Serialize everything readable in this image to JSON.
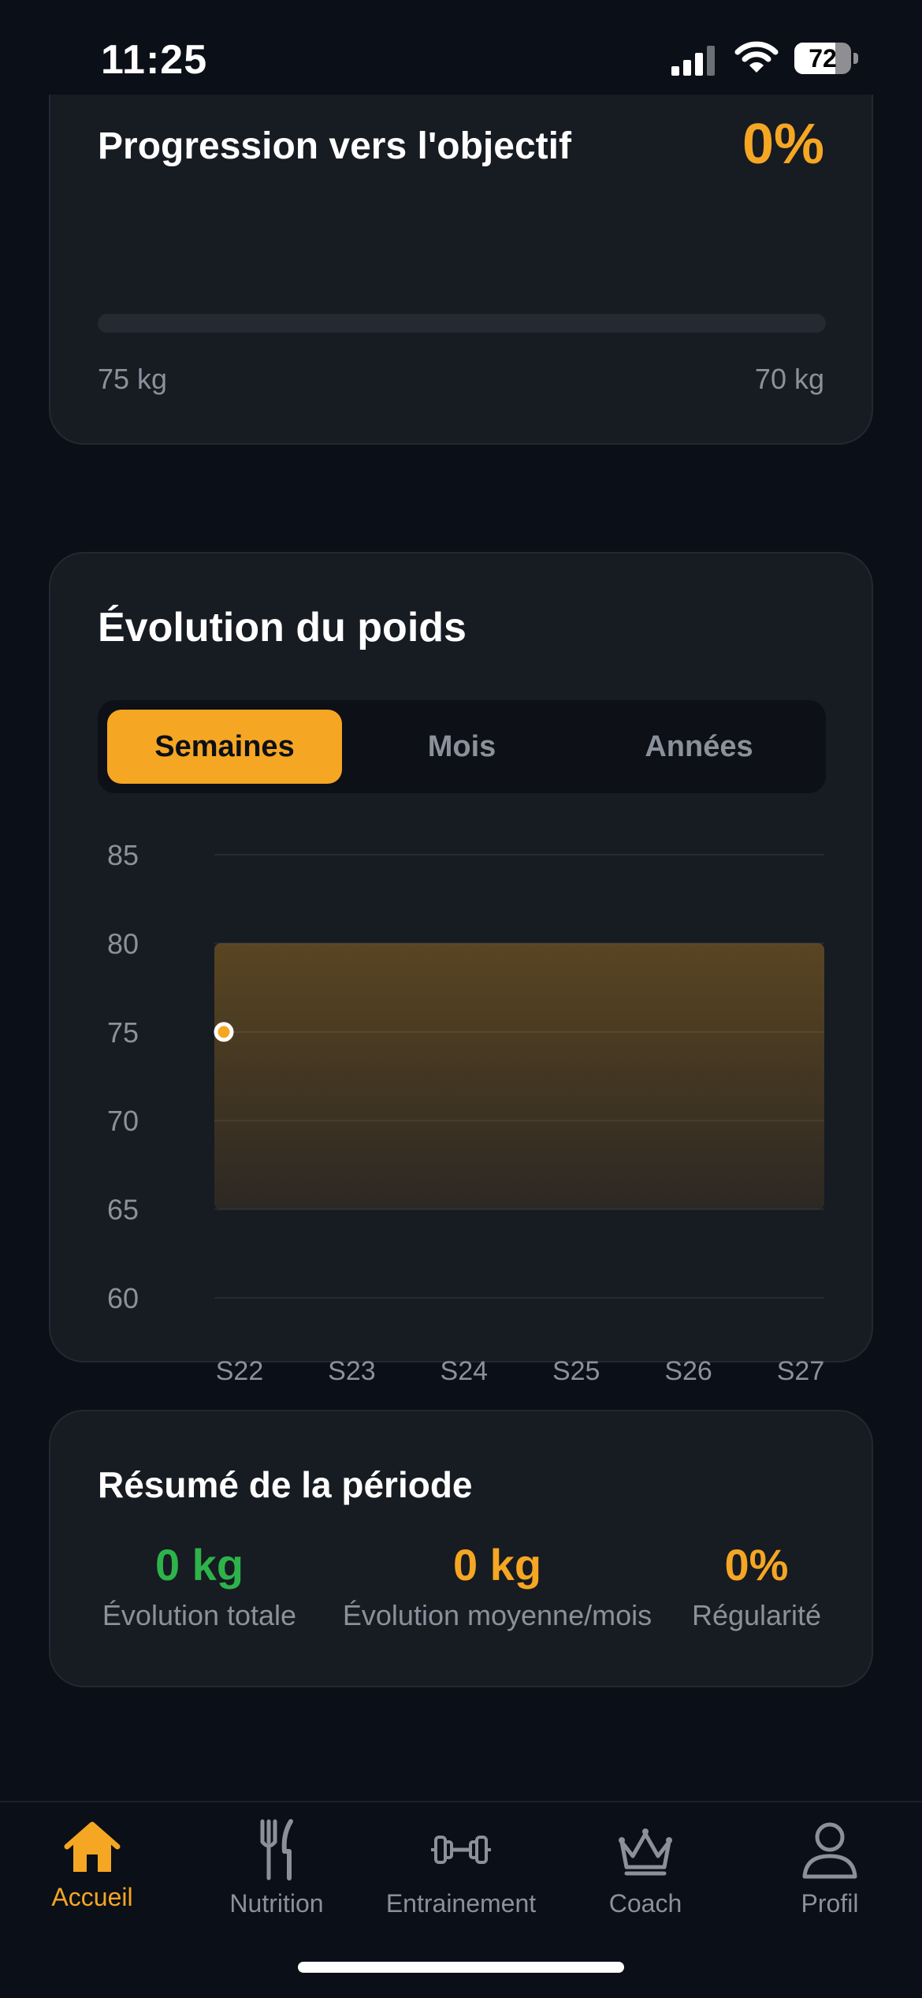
{
  "status_bar": {
    "time": "11:25",
    "battery": "72",
    "battery_level": 72
  },
  "goal_card": {
    "title": "Progression vers l'objectif",
    "percent": "0%",
    "progress": 0,
    "start_weight": "75 kg",
    "target_weight": "70 kg"
  },
  "weight_card": {
    "title": "Évolution du poids",
    "tabs": [
      {
        "label": "Semaines",
        "active": true
      },
      {
        "label": "Mois",
        "active": false
      },
      {
        "label": "Années",
        "active": false
      }
    ]
  },
  "chart_data": {
    "type": "line",
    "title": "",
    "x": [
      "S22",
      "S23",
      "S24",
      "S25",
      "S26",
      "S27"
    ],
    "yticks": [
      85,
      80,
      75,
      70,
      65,
      60
    ],
    "ylim": [
      60,
      85
    ],
    "series": [
      {
        "values": [
          75
        ]
      }
    ],
    "shaded_band": [
      65,
      80
    ],
    "grid": true,
    "colors": {
      "line": "#f5a623",
      "band": "#5a4522"
    }
  },
  "summary": {
    "title": "Résumé de la période",
    "stats": [
      {
        "value": "0 kg",
        "label": "Évolution totale",
        "color": "#2db34a"
      },
      {
        "value": "0 kg",
        "label": "Évolution moyenne/mois",
        "color": "#f5a623"
      },
      {
        "value": "0%",
        "label": "Régularité",
        "color": "#f5a623"
      }
    ]
  },
  "tabbar": {
    "items": [
      {
        "label": "Accueil",
        "icon": "home-icon",
        "active": true
      },
      {
        "label": "Nutrition",
        "icon": "fork-knife-icon",
        "active": false
      },
      {
        "label": "Entrainement",
        "icon": "dumbbell-icon",
        "active": false
      },
      {
        "label": "Coach",
        "icon": "crown-icon",
        "active": false
      },
      {
        "label": "Profil",
        "icon": "person-icon",
        "active": false
      }
    ]
  },
  "colors": {
    "accent": "#f5a623",
    "positive": "#2db34a",
    "background": "#0b0f17",
    "card": "#171b22"
  }
}
